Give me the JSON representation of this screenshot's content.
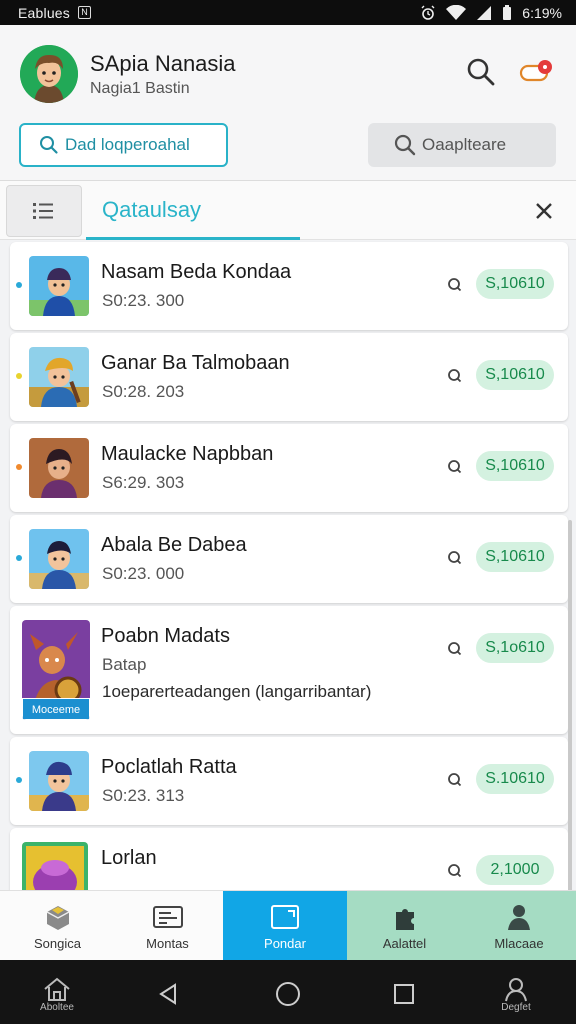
{
  "status_bar": {
    "carrier": "Eablues",
    "nfc_badge": "N",
    "battery": "6:19%"
  },
  "header": {
    "user_name": "SApia Nanasia",
    "user_subtitle": "Nagia1 Bastin",
    "search_button_label": "Dad loqperoahal",
    "filter_button_label": "Oaaplteare"
  },
  "tab": {
    "label": "Qataulsay"
  },
  "items": [
    {
      "title": "Nasam Beda Kondaa",
      "subtitle": "S0:23. 300",
      "price": "S,10610",
      "dot_color": "#2aa9d8"
    },
    {
      "title": "Ganar Ba Talmobaan",
      "subtitle": "S0:28. 203",
      "price": "S,10610",
      "dot_color": "#e8d32e"
    },
    {
      "title": "Maulacke Napbban",
      "subtitle": "S6:29. 303",
      "price": "S,10610",
      "dot_color": "#f08a2e"
    },
    {
      "title": "Abala Be Dabea",
      "subtitle": "S0:23. 000",
      "price": "S,10610",
      "dot_color": "#2aa9d8"
    },
    {
      "title": "Poabn Madats",
      "subtitle": "Batap",
      "extra": "1oeparerteadangen (langarribantar)",
      "badge": "Moceeme",
      "price": "S,1o610",
      "dot_color": ""
    },
    {
      "title": "Poclatlah Ratta",
      "subtitle": "S0:23. 313",
      "price": "S.10610",
      "dot_color": "#2aa9d8"
    },
    {
      "title": "Lorlan",
      "subtitle": "",
      "price": "2,1000",
      "dot_color": ""
    }
  ],
  "bottom_nav": [
    {
      "label": "Songica",
      "icon": "box-icon"
    },
    {
      "label": "Montas",
      "icon": "keyboard-icon"
    },
    {
      "label": "Pondar",
      "icon": "folder-icon",
      "active": true
    },
    {
      "label": "Aalattel",
      "icon": "puzzle-icon"
    },
    {
      "label": "Mlacaae",
      "icon": "person-icon"
    }
  ],
  "system_nav": {
    "home_label": "Aboltee",
    "account_label": "Degfet"
  }
}
